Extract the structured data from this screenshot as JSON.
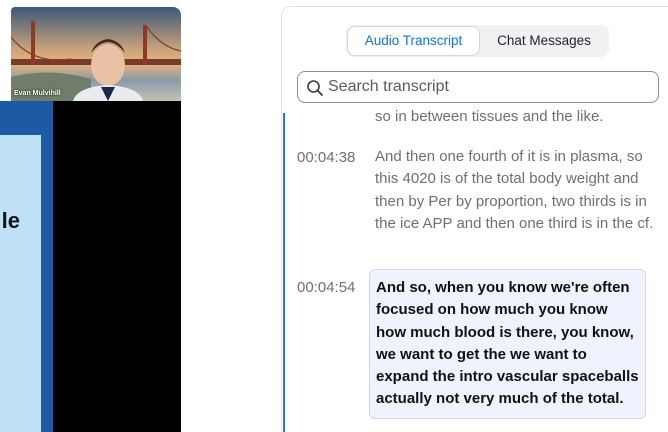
{
  "participant": {
    "name": "Evan Mulvihill"
  },
  "shared_screen": {
    "partial_text": "le"
  },
  "transcript_panel": {
    "tabs": [
      {
        "label": "Audio Transcript",
        "active": true
      },
      {
        "label": "Chat Messages",
        "active": false
      }
    ],
    "search": {
      "placeholder": "Search transcript",
      "icon": "search-icon"
    },
    "fragment_text": "so in between tissues and the like.",
    "entries": [
      {
        "time": "00:04:38",
        "text": "And then one fourth of it is in plasma, so this 4020 is of the total body weight and then by Per by proportion, two thirds is in the ice APP and then one third is in the cf."
      },
      {
        "time": "00:04:54",
        "text": "And so, when you know we're often focused on how much you know how much blood is there, you know, we want to get the we want to expand the intro vascular spaceballs actually not very much of the total."
      }
    ]
  },
  "colors": {
    "accent": "#0e72ed",
    "share_blue": "#1c5aa6",
    "highlight_bg": "#eef3fd"
  }
}
